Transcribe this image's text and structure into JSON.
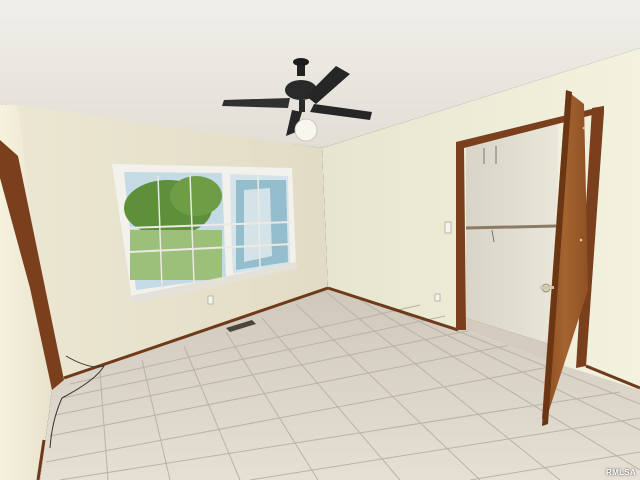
{
  "watermark": "RMLSA",
  "colors": {
    "ceiling": "#ece9e3",
    "wall_back": "#e8e3cf",
    "wall_right": "#eeeed8",
    "wall_left": "#f0ecd6",
    "floor_tile": "#ddd6ca",
    "grout": "#b9b1a3",
    "wood_trim": "#7a3f1c",
    "door_wood": "#9a5a2b",
    "window_frame": "#f2f0ea",
    "window_glass": "#bcd6e3",
    "foliage": "#5e8f3a"
  },
  "icons": [
    "ceiling-fan-icon",
    "light-switch-icon",
    "outlet-icon",
    "door-knob-icon",
    "floor-vent-icon"
  ]
}
